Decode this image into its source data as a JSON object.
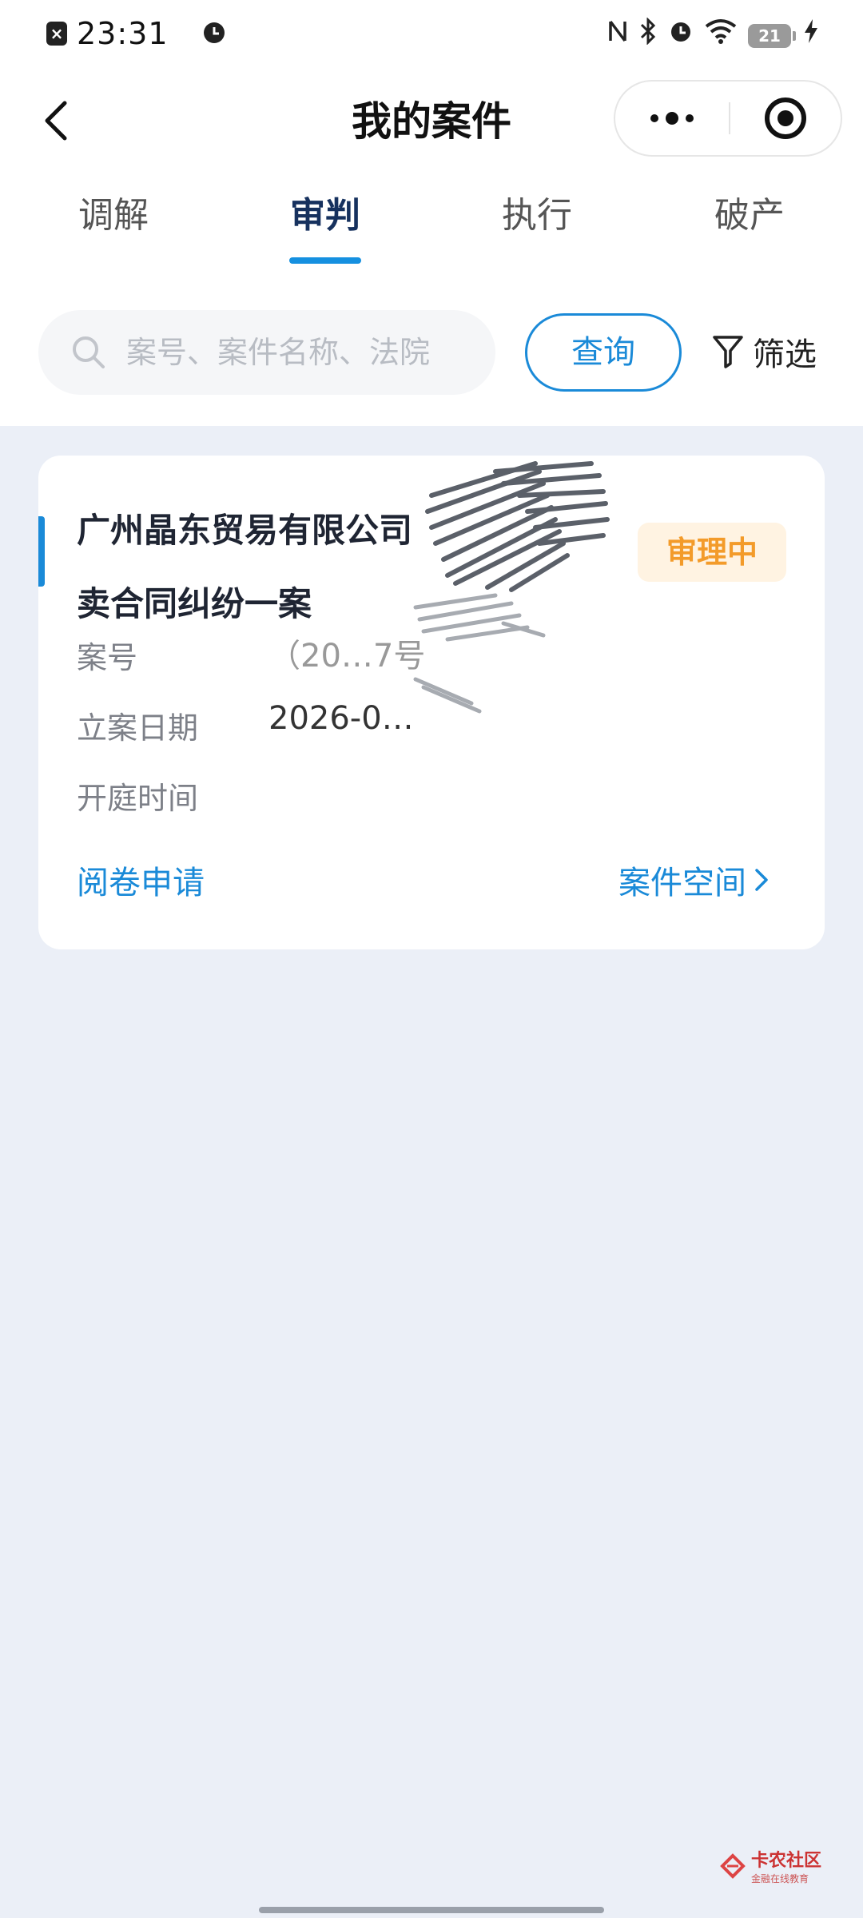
{
  "status_bar": {
    "time": "23:31",
    "notification_icon": "close-notification-icon",
    "right_icons": [
      "nfc-icon",
      "bluetooth-icon",
      "alarm-icon",
      "wifi-icon"
    ],
    "battery_level": "21"
  },
  "nav": {
    "title": "我的案件",
    "back_icon": "chevron-left-icon",
    "more_icon": "more-dots-icon",
    "close_icon": "target-close-icon"
  },
  "tabs": [
    {
      "label": "调解",
      "active": false
    },
    {
      "label": "审判",
      "active": true
    },
    {
      "label": "执行",
      "active": false
    },
    {
      "label": "破产",
      "active": false
    }
  ],
  "search": {
    "placeholder": "案号、案件名称、法院",
    "query_label": "查询",
    "filter_label": "筛选"
  },
  "case_card": {
    "title_line1": "广州晶东贸易有限公司",
    "title_line2": "卖合同纠纷一案",
    "status": "审理中",
    "fields": [
      {
        "label": "案号",
        "value": "（20…7号"
      },
      {
        "label": "立案日期",
        "value": "2026-0…"
      },
      {
        "label": "开庭时间",
        "value": ""
      }
    ],
    "left_action": "阅卷申请",
    "right_action": "案件空间"
  },
  "watermark": {
    "title": "卡农社区",
    "subtitle": "金融在线教育"
  },
  "colors": {
    "accent": "#1a8ad8",
    "status_orange": "#f39b2a",
    "background": "#ebeff7"
  }
}
